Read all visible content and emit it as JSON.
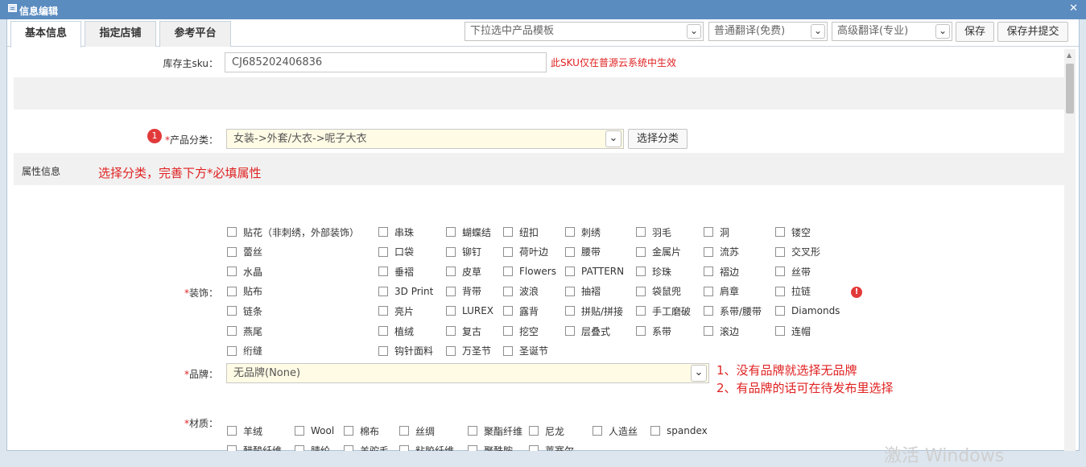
{
  "window": {
    "title": "信息编辑",
    "close_glyph": "✕"
  },
  "tabs": [
    {
      "label": "基本信息"
    },
    {
      "label": "指定店铺"
    },
    {
      "label": "参考平台"
    }
  ],
  "toolbar": {
    "template_select": "下拉选中产品模板",
    "normal_translate": "普通翻译(免费)",
    "advanced_translate": "高级翻译(专业)",
    "save_label": "保存",
    "save_submit_label": "保存并提交"
  },
  "sku": {
    "label": "库存主sku：",
    "value": "CJ685202406836",
    "note": "此SKU仅在普源云系统中生效"
  },
  "category": {
    "step": "1",
    "required_mark": "*",
    "label": "产品分类：",
    "value": "女装->外套/大衣->呢子大衣",
    "button": "选择分类"
  },
  "attributes": {
    "label": "属性信息",
    "hint": "选择分类，完善下方*必填属性"
  },
  "decoration": {
    "required_mark": "*",
    "label": "装饰：",
    "options": [
      [
        "贴花（非刺绣，外部装饰）",
        "串珠",
        "蝴蝶结",
        "纽扣",
        "刺绣",
        "羽毛",
        "洞",
        "镂空"
      ],
      [
        "蕾丝",
        "口袋",
        "铆钉",
        "荷叶边",
        "腰带",
        "金属片",
        "流苏",
        "交叉形"
      ],
      [
        "水晶",
        "垂褶",
        "皮草",
        "Flowers",
        "PATTERN",
        "珍珠",
        "褶边",
        "丝带"
      ],
      [
        "贴布",
        "3D Print",
        "背带",
        "波浪",
        "抽褶",
        "袋鼠兜",
        "肩章",
        "拉链"
      ],
      [
        "链条",
        "亮片",
        "LUREX",
        "露背",
        "拼贴/拼接",
        "手工磨破",
        "系带/腰带",
        "Diamonds"
      ],
      [
        "燕尾",
        "植绒",
        "复古",
        "挖空",
        "层叠式",
        "系带",
        "滚边",
        "连帽"
      ],
      [
        "绗缝",
        "钩针面料",
        "万圣节",
        "圣诞节"
      ]
    ],
    "error_glyph": "!"
  },
  "brand": {
    "required_mark": "*",
    "label": "品牌：",
    "value": "无品牌(None)",
    "note1": "1、没有品牌就选择无品牌",
    "note2": "2、有品牌的话可在待发布里选择"
  },
  "material": {
    "required_mark": "*",
    "label": "材质：",
    "options": [
      [
        "羊绒",
        "Wool",
        "棉布",
        "丝绸",
        "聚酯纤维",
        "尼龙",
        "人造丝",
        "spandex"
      ],
      [
        "醋酸纤维",
        "腈纶",
        "羊驼毛",
        "粘胶纤维",
        "聚酰胺",
        "莱赛尔"
      ]
    ]
  },
  "watermark": "激活 Windows",
  "colors": {
    "title_bar": "#5b8cc0",
    "required": "#e02222",
    "highlight_field": "#fffbe5"
  }
}
